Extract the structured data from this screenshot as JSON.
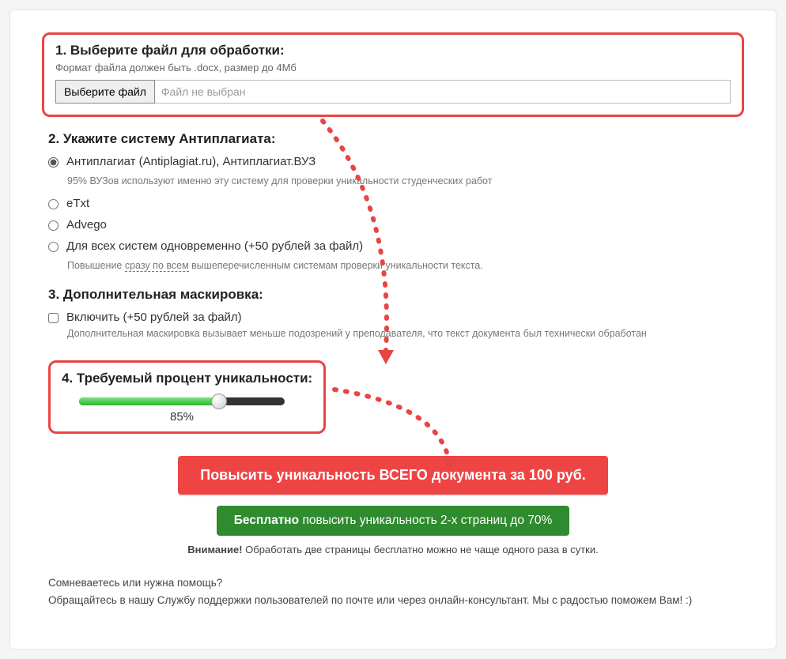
{
  "step1": {
    "title": "1. Выберите файл для обработки:",
    "sub": "Формат файла должен быть .docx, размер до 4Мб",
    "button": "Выберите файл",
    "status": "Файл не выбран"
  },
  "step2": {
    "title": "2. Укажите систему Антиплагиата:",
    "options": [
      {
        "label": "Антиплагиат (Antiplagiat.ru), Антиплагиат.ВУЗ",
        "desc": "95% ВУЗов используют именно эту систему для проверки уникальности студенческих работ",
        "checked": true
      },
      {
        "label": "eTxt",
        "desc": "",
        "checked": false
      },
      {
        "label": "Advego",
        "desc": "",
        "checked": false
      },
      {
        "label": "Для всех систем одновременно (+50 рублей за файл)",
        "desc_pre": "Повышение ",
        "desc_u": "сразу по всем",
        "desc_post": " вышеперечисленным системам проверки уникальности текста.",
        "checked": false
      }
    ]
  },
  "step3": {
    "title": "3. Дополнительная маскировка:",
    "label": "Включить (+50 рублей за файл)",
    "desc": "Дополнительная маскировка вызывает меньше подозрений у преподавателя, что текст документа был технически обработан"
  },
  "step4": {
    "title": "4. Требуемый процент уникальности:",
    "value": "85%",
    "percent": 68
  },
  "buttons": {
    "red": "Повысить уникальность ВСЕГО документа за 100 руб.",
    "green_bold": "Бесплатно",
    "green_rest": " повысить уникальность 2-х страниц до 70%"
  },
  "notice": {
    "bold": "Внимание!",
    "rest": " Обработать две страницы бесплатно можно не чаще одного раза в сутки."
  },
  "help": {
    "line1": "Сомневаетесь или нужна помощь?",
    "line2": "Обращайтесь в нашу Службу поддержки пользователей по почте или через онлайн-консультант. Мы с радостью поможем Вам! :)"
  }
}
